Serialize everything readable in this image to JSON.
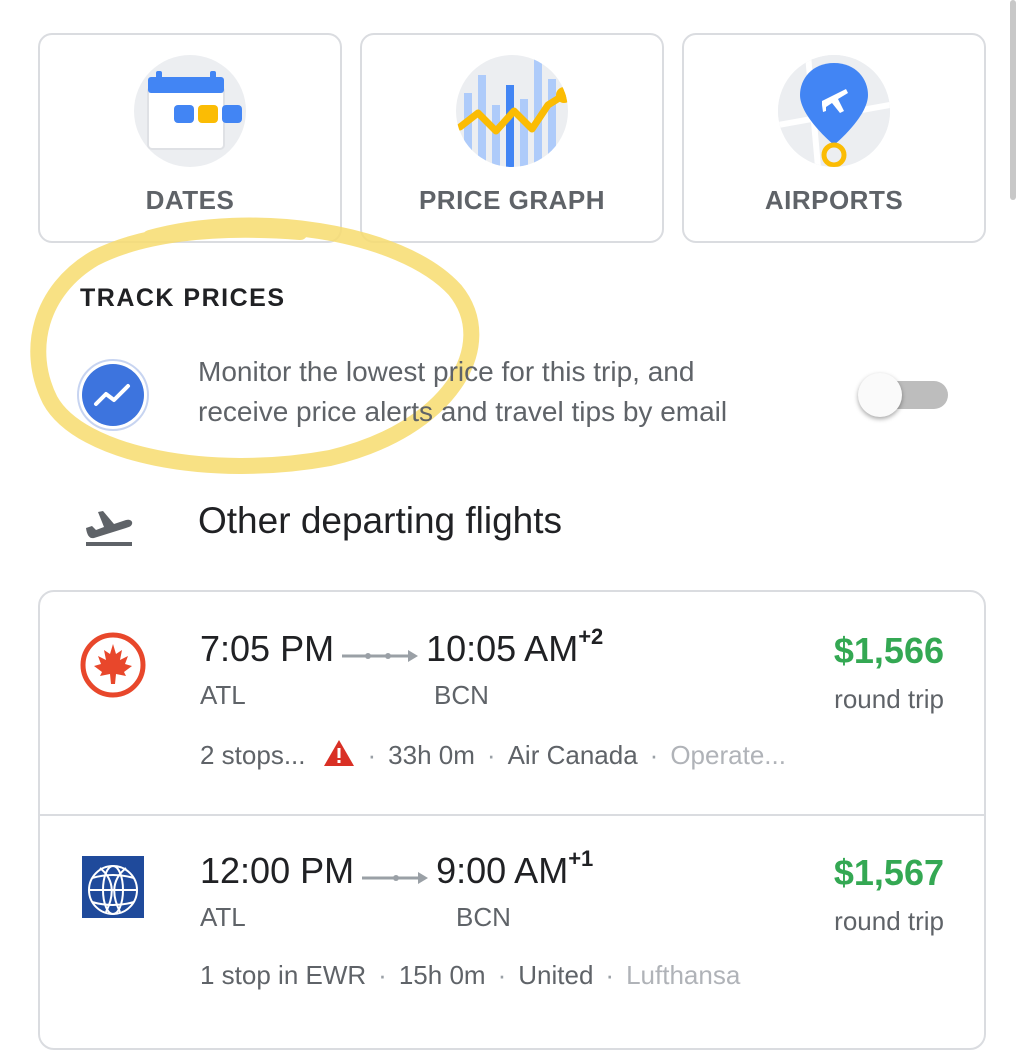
{
  "tiles": [
    {
      "label": "DATES",
      "icon": "calendar-icon"
    },
    {
      "label": "PRICE GRAPH",
      "icon": "price-graph-icon"
    },
    {
      "label": "AIRPORTS",
      "icon": "airport-pin-icon"
    }
  ],
  "track": {
    "heading": "TRACK PRICES",
    "line1": "Monitor the lowest price for this trip, and",
    "line2": "receive price alerts and travel tips by email",
    "toggle_on": false
  },
  "other": {
    "heading": "Other departing flights"
  },
  "flights": [
    {
      "airline_icon": "air-canada-maple-leaf-icon",
      "depart": "7:05 PM",
      "arrive": "10:05 AM",
      "day_offset": "+2",
      "from": "ATL",
      "to": "BCN",
      "price": "$1,566",
      "trip": "round trip",
      "stops": "2 stops...",
      "duration": "33h 0m",
      "airline": "Air Canada",
      "operated": "Operate..."
    },
    {
      "airline_icon": "united-globe-icon",
      "depart": "12:00 PM",
      "arrive": "9:00 AM",
      "day_offset": "+1",
      "from": "ATL",
      "to": "BCN",
      "price": "$1,567",
      "trip": "round trip",
      "stops": "1 stop in EWR",
      "duration": "15h 0m",
      "airline": "United",
      "operated": "Lufthansa"
    }
  ],
  "colors": {
    "price_green": "#34a853",
    "google_blue": "#4285f4",
    "highlight_yellow": "#f7dc6f",
    "air_canada_red": "#e8472b",
    "united_blue": "#1f4a9b"
  }
}
